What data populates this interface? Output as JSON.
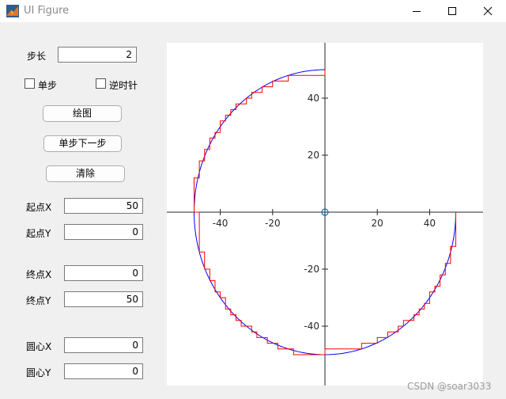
{
  "window": {
    "title": "UI Figure",
    "watermark": "CSDN @soar3033"
  },
  "controls": {
    "step_label": "步长",
    "step_value": "2",
    "single_step_label": "单步",
    "single_step_checked": false,
    "counterclockwise_label": "逆时针",
    "counterclockwise_checked": false,
    "plot_button": "绘图",
    "next_step_button": "单步下一步",
    "clear_button": "清除",
    "start_x_label": "起点X",
    "start_x_value": "50",
    "start_y_label": "起点Y",
    "start_y_value": "0",
    "end_x_label": "终点X",
    "end_x_value": "0",
    "end_y_label": "终点Y",
    "end_y_value": "50",
    "center_x_label": "圆心X",
    "center_x_value": "0",
    "center_y_label": "圆心Y",
    "center_y_value": "0"
  },
  "chart_data": {
    "type": "line",
    "xlim": [
      -60,
      60
    ],
    "ylim": [
      -60,
      60
    ],
    "x_ticks": [
      -40,
      -20,
      20,
      40
    ],
    "y_ticks": [
      40,
      20,
      -20,
      -40
    ],
    "grid": false,
    "radius": 50,
    "arc_start_deg": 0,
    "arc_end_deg": 90,
    "direction": "clockwise",
    "step": 2,
    "series": [
      {
        "color": "#0000ff",
        "kind": "ideal-arc"
      },
      {
        "color": "#ff0000",
        "kind": "interpolation-steps"
      }
    ],
    "origin_marker_color": "#0072bd"
  }
}
